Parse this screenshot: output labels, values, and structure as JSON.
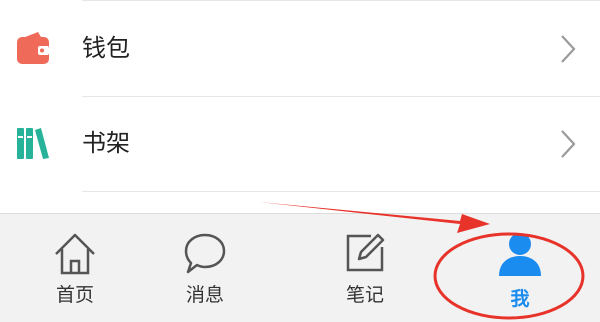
{
  "menu": {
    "items": [
      {
        "label": "钱包",
        "icon": "wallet-icon"
      },
      {
        "label": "书架",
        "icon": "bookshelf-icon"
      }
    ]
  },
  "tabbar": {
    "tabs": [
      {
        "label": "首页",
        "icon": "home-icon",
        "active": false
      },
      {
        "label": "消息",
        "icon": "chat-bubble-icon",
        "active": false
      },
      {
        "label": "笔记",
        "icon": "edit-note-icon",
        "active": false
      },
      {
        "label": "我",
        "icon": "user-icon",
        "active": true
      }
    ]
  },
  "colors": {
    "wallet": "#f06a5a",
    "bookshelf": "#26b39a",
    "active_tab": "#1a8cf0",
    "annotation": "#e8332a",
    "tabbar_bg": "#f2f2f2"
  }
}
